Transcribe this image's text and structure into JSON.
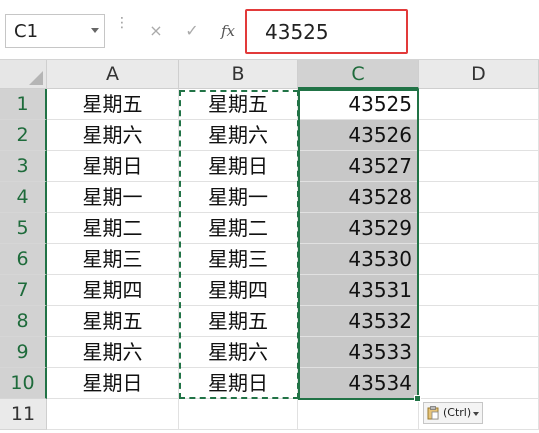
{
  "formula_bar": {
    "name_box": "C1",
    "cancel_glyph": "×",
    "enter_glyph": "✓",
    "fx_label": "fx",
    "formula_value": "43525"
  },
  "columns": [
    "A",
    "B",
    "C",
    "D"
  ],
  "rows": [
    {
      "num": "1",
      "a": "星期五",
      "b": "星期五",
      "c": "43525"
    },
    {
      "num": "2",
      "a": "星期六",
      "b": "星期六",
      "c": "43526"
    },
    {
      "num": "3",
      "a": "星期日",
      "b": "星期日",
      "c": "43527"
    },
    {
      "num": "4",
      "a": "星期一",
      "b": "星期一",
      "c": "43528"
    },
    {
      "num": "5",
      "a": "星期二",
      "b": "星期二",
      "c": "43529"
    },
    {
      "num": "6",
      "a": "星期三",
      "b": "星期三",
      "c": "43530"
    },
    {
      "num": "7",
      "a": "星期四",
      "b": "星期四",
      "c": "43531"
    },
    {
      "num": "8",
      "a": "星期五",
      "b": "星期五",
      "c": "43532"
    },
    {
      "num": "9",
      "a": "星期六",
      "b": "星期六",
      "c": "43533"
    },
    {
      "num": "10",
      "a": "星期日",
      "b": "星期日",
      "c": "43534"
    },
    {
      "num": "11",
      "a": "",
      "b": "",
      "c": ""
    }
  ],
  "paste_options": {
    "label": "(Ctrl)"
  },
  "colors": {
    "accent": "#217346",
    "highlight": "#e23a3a",
    "selection_fill": "#c8c8c8"
  }
}
